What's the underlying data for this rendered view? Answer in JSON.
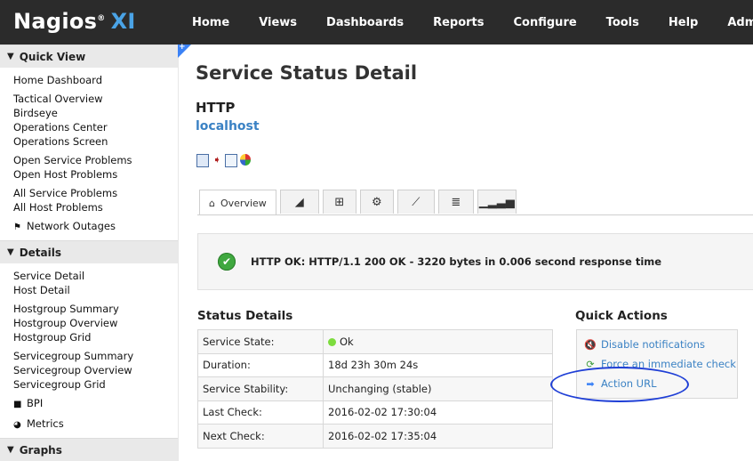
{
  "brand": {
    "name": "Nagios",
    "reg": "®",
    "suffix": "XI"
  },
  "nav": [
    "Home",
    "Views",
    "Dashboards",
    "Reports",
    "Configure",
    "Tools",
    "Help",
    "Admin"
  ],
  "sidebar": {
    "quick_view": {
      "title": "Quick View",
      "items": [
        "Home Dashboard",
        "Tactical Overview",
        "Birdseye",
        "Operations Center",
        "Operations Screen",
        "Open Service Problems",
        "Open Host Problems",
        "All Service Problems",
        "All Host Problems",
        "Network Outages"
      ]
    },
    "details": {
      "title": "Details",
      "items": [
        "Service Detail",
        "Host Detail",
        "Hostgroup Summary",
        "Hostgroup Overview",
        "Hostgroup Grid",
        "Servicegroup Summary",
        "Servicegroup Overview",
        "Servicegroup Grid",
        "BPI",
        "Metrics"
      ]
    },
    "graphs": {
      "title": "Graphs"
    }
  },
  "page": {
    "title": "Service Status Detail",
    "service": "HTTP",
    "host": "localhost"
  },
  "tabs": {
    "overview": "Overview"
  },
  "status": {
    "text": "HTTP OK: HTTP/1.1 200 OK - 3220 bytes in 0.006 second response time"
  },
  "status_details": {
    "title": "Status Details",
    "rows": [
      {
        "k": "Service State:",
        "v": "Ok"
      },
      {
        "k": "Duration:",
        "v": "18d 23h 30m 24s"
      },
      {
        "k": "Service Stability:",
        "v": "Unchanging (stable)"
      },
      {
        "k": "Last Check:",
        "v": "2016-02-02 17:30:04"
      },
      {
        "k": "Next Check:",
        "v": "2016-02-02 17:35:04"
      }
    ]
  },
  "quick_actions": {
    "title": "Quick Actions",
    "items": [
      "Disable notifications",
      "Force an immediate check",
      "Action URL"
    ]
  },
  "colors": {
    "topbar": "#2b2b2b",
    "link": "#3b82c4",
    "ok": "#3fa83f",
    "highlight": "#1f3fd6"
  }
}
